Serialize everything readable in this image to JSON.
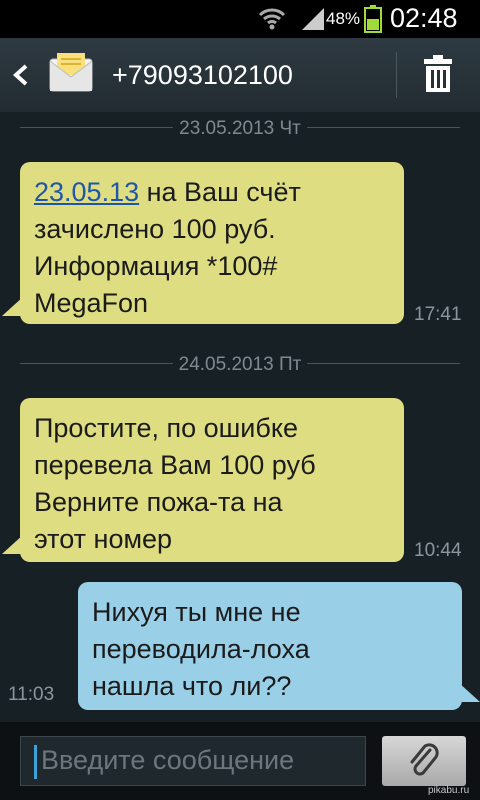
{
  "status_bar": {
    "battery_percent": "48%",
    "time": "02:48",
    "icons": [
      "wifi-icon",
      "signal-icon",
      "battery-icon"
    ]
  },
  "header": {
    "title": "+79093102100",
    "icons": [
      "back-icon",
      "envelope-icon",
      "trash-icon"
    ]
  },
  "conversation": {
    "date_separators": [
      "23.05.2013 Чт",
      "24.05.2013 Пт"
    ],
    "messages": [
      {
        "direction": "incoming",
        "link": "23.05.13",
        "line1_rest": " на Ваш счёт",
        "lines": [
          "зачислено 100 руб.",
          "Информация *100#",
          "MegaFon"
        ],
        "time": "17:41"
      },
      {
        "direction": "incoming",
        "lines": [
          "Простите, по ошибке",
          "перевела Вам 100 руб",
          "Верните пожа-та на",
          "этот номер"
        ],
        "time": "10:44"
      },
      {
        "direction": "outgoing",
        "lines": [
          "Нихуя ты мне не",
          "переводила-лоха",
          "нашла что ли??"
        ],
        "time": "11:03"
      }
    ]
  },
  "composer": {
    "placeholder": "Введите сообщение",
    "attach_icon": "paperclip-icon"
  },
  "watermark": "pikabu.ru",
  "colors": {
    "incoming_bubble": "#dedd82",
    "outgoing_bubble": "#9acfe8",
    "link": "#1f56a8",
    "background": "#172025"
  }
}
